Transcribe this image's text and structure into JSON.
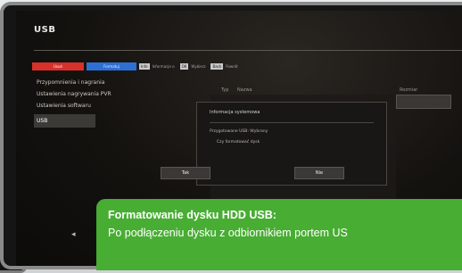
{
  "screen": {
    "title": "USB",
    "keys": {
      "red": "Usuń",
      "blue": "Formatuj",
      "info_tag": "Info",
      "info_text": "Informacje o",
      "ok_tag": "OK",
      "ok_text": "Wybierz",
      "back_tag": "Back",
      "back_text": "Powrót"
    },
    "menu": {
      "items": [
        {
          "label": "Przypomnienia i nagrania"
        },
        {
          "label": "Ustawienia nagrywania PVR"
        },
        {
          "label": "Ustawienia softwaru"
        },
        {
          "label": "USB"
        }
      ]
    },
    "file_list": {
      "col_type": "Typ",
      "col_name": "Nazwa",
      "col_size": "Rozmiar"
    },
    "dialog": {
      "title": "Informacja systemowa",
      "line1": "Przygotowane USB: Wybrany",
      "line2": "Czy formatować dysk"
    },
    "buttons": {
      "yes": "Tak",
      "no": "Nie"
    },
    "nav_arrow": "◂"
  },
  "callout": {
    "title": "Formatowanie dysku HDD USB:",
    "body": "Po podłączeniu dysku z odbiornikiem portem US"
  },
  "colors": {
    "accent_green": "#48ad33",
    "key_red": "#d6312b",
    "key_blue": "#2e6fd4"
  }
}
